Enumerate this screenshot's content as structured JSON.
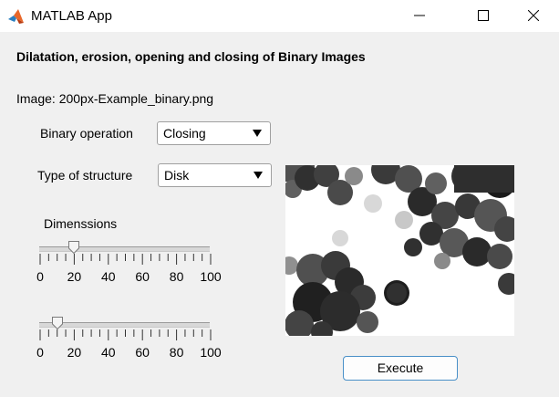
{
  "window": {
    "title": "MATLAB App",
    "icon": "matlab-logo-icon"
  },
  "heading": "Dilatation, erosion, opening and closing of Binary Images",
  "image_label": "Image: 200px-Example_binary.png",
  "binary_operation": {
    "label": "Binary operation",
    "value": "Closing"
  },
  "structure_type": {
    "label": "Type of structure",
    "value": "Disk"
  },
  "dimensions": {
    "label": "Dimenssions",
    "slider1_value": 20,
    "slider2_value": 10,
    "min": 0,
    "max": 100,
    "tick_labels": [
      "0",
      "20",
      "40",
      "60",
      "80",
      "100"
    ]
  },
  "execute_label": "Execute",
  "colors": {
    "button_border": "#4a90c8",
    "background": "#f0f0f0"
  }
}
